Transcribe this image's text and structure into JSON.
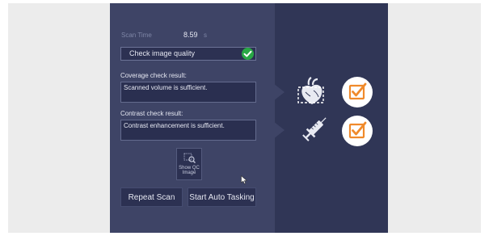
{
  "scan": {
    "time_label": "Scan Time",
    "time_value": "8.59",
    "time_unit": "s"
  },
  "quality_check": {
    "label": "Check image quality",
    "status_icon": "checkmark-circle-icon",
    "status_color": "#29a845"
  },
  "coverage": {
    "label": "Coverage check result:",
    "result": "Scanned volume is sufficient."
  },
  "contrast": {
    "label": "Contrast check result:",
    "result": "Contrast enhancement is sufficient."
  },
  "qc_button": {
    "label_line1": "Show QC",
    "label_line2": "Image",
    "icon": "magnify-image-icon"
  },
  "actions": {
    "repeat_label": "Repeat Scan",
    "auto_label": "Start Auto Tasking"
  },
  "side_status": {
    "accent_color": "#f08a2b",
    "coverage_icon": "heart-volume-icon",
    "contrast_icon": "syringe-icon",
    "check_icon": "checkbox-check-icon"
  }
}
